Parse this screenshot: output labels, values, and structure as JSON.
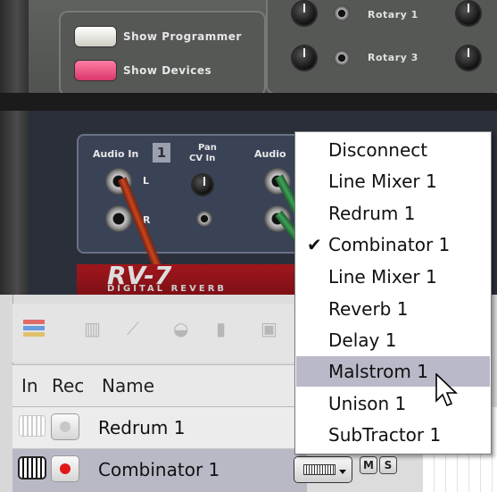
{
  "rack": {
    "show_programmer_label": "Show Programmer",
    "show_devices_label": "Show Devices",
    "rotary_1_label": "Rotary 1",
    "rotary_3_label": "Rotary 3",
    "audio_in_label": "Audio In",
    "audio_in_channel": "1",
    "audio_in_2_label": "Audio",
    "pan_label": "Pan",
    "cv_in_label": "CV In",
    "jack_l_label": "L",
    "jack_r_label": "R",
    "device_name": "RV-7",
    "device_subtitle": "DIGITAL REVERB",
    "colors": {
      "cable_red": "#c4481f",
      "cable_green": "#3fa25a",
      "device_red": "#a0171d"
    }
  },
  "sequencer": {
    "toolbar_icons": [
      "track-list-icon",
      "keyboard-icon",
      "automation-icon",
      "drum-icon",
      "bars-icon",
      "device-icon"
    ],
    "columns": {
      "in": "In",
      "rec": "Rec",
      "name": "Name"
    },
    "tracks": [
      {
        "name": "Redrum 1",
        "selected": false,
        "recording": false
      },
      {
        "name": "Combinator 1",
        "selected": true,
        "recording": true
      }
    ],
    "mute_label": "M",
    "solo_label": "S"
  },
  "menu": {
    "items": [
      {
        "label": "Disconnect",
        "checked": false,
        "highlighted": false
      },
      {
        "label": "Line Mixer 1",
        "checked": false,
        "highlighted": false
      },
      {
        "label": "Redrum 1",
        "checked": false,
        "highlighted": false
      },
      {
        "label": "Combinator 1",
        "checked": true,
        "highlighted": false
      },
      {
        "label": "Line Mixer 1",
        "checked": false,
        "highlighted": false
      },
      {
        "label": "Reverb 1",
        "checked": false,
        "highlighted": false
      },
      {
        "label": "Delay 1",
        "checked": false,
        "highlighted": false
      },
      {
        "label": "Malstrom 1",
        "checked": false,
        "highlighted": true
      },
      {
        "label": "Unison 1",
        "checked": false,
        "highlighted": false
      },
      {
        "label": "SubTractor 1",
        "checked": false,
        "highlighted": false
      }
    ],
    "check_mark": "✔",
    "highlight_color": "#b9b9c9"
  }
}
